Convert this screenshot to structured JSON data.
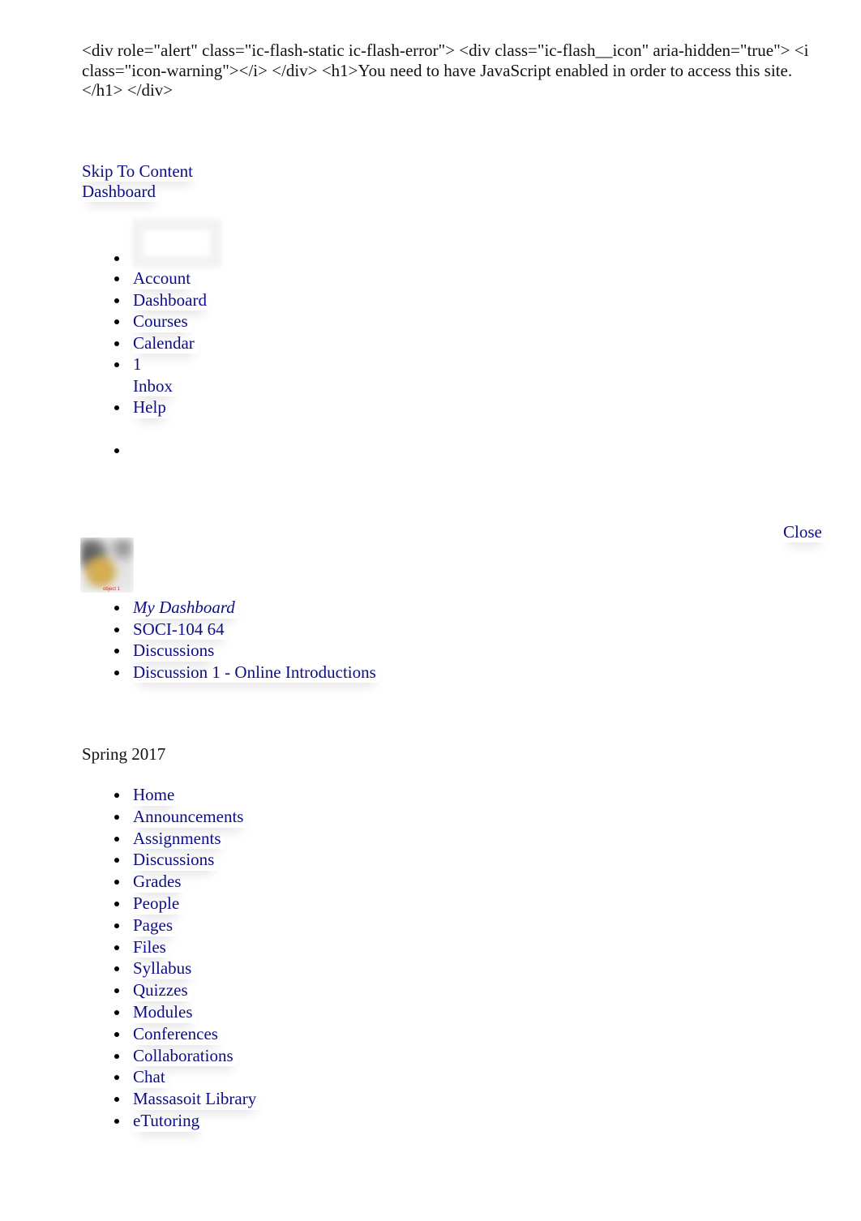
{
  "noscript_message": "<div role=\"alert\" class=\"ic-flash-static ic-flash-error\"> <div class=\"ic-flash__icon\" aria-hidden=\"true\"> <i class=\"icon-warning\"></i> </div> <h1>You need to have JavaScript enabled in order to access this site.</h1> </div>",
  "skip_links": {
    "skip_to_content": "Skip To Content",
    "dashboard": "Dashboard"
  },
  "global_nav": {
    "account": "Account",
    "dashboard": "Dashboard",
    "courses": "Courses",
    "calendar": "Calendar",
    "inbox_count": "1",
    "inbox": "Inbox",
    "help": "Help"
  },
  "close_label": "Close",
  "course_image": {
    "caption": "object 1"
  },
  "breadcrumbs": [
    {
      "label": "My Dashboard"
    },
    {
      "label": "SOCI-104 64"
    },
    {
      "label": "Discussions"
    },
    {
      "label": "Discussion 1 - Online Introductions"
    }
  ],
  "term": "Spring 2017",
  "course_nav": [
    {
      "label": "Home"
    },
    {
      "label": "Announcements"
    },
    {
      "label": "Assignments"
    },
    {
      "label": "Discussions"
    },
    {
      "label": "Grades"
    },
    {
      "label": "People"
    },
    {
      "label": "Pages"
    },
    {
      "label": "Files"
    },
    {
      "label": "Syllabus"
    },
    {
      "label": "Quizzes"
    },
    {
      "label": "Modules"
    },
    {
      "label": "Conferences"
    },
    {
      "label": "Collaborations"
    },
    {
      "label": "Chat"
    },
    {
      "label": "Massasoit Library"
    },
    {
      "label": "eTutoring"
    }
  ],
  "colors": {
    "link": "#0d0d86",
    "text": "#111111",
    "caption": "#e02020"
  }
}
